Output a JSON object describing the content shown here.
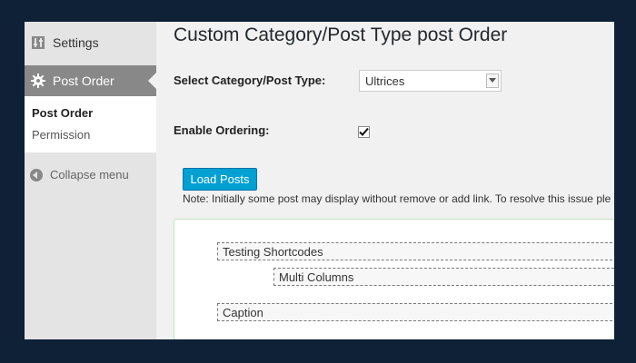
{
  "sidebar": {
    "settings_label": "Settings",
    "post_order_label": "Post Order",
    "submenu": {
      "post_order": "Post Order",
      "permission": "Permission"
    },
    "collapse_label": "Collapse menu"
  },
  "main": {
    "title": "Custom Category/Post Type post Order",
    "select_label": "Select Category/Post Type:",
    "select_value": "Ultrices",
    "enable_label": "Enable Ordering:",
    "enable_checked": true,
    "load_button": "Load Posts",
    "note": "Note: Initially some post may display without remove or add link. To resolve this issue ple"
  },
  "sortable": {
    "items": [
      {
        "label": "Testing Shortcodes"
      },
      {
        "label": "Multi Columns"
      },
      {
        "label": "Caption"
      }
    ]
  },
  "colors": {
    "accent": "#00a0d2",
    "sidebar_active": "#888888",
    "background": "#0e2136"
  }
}
